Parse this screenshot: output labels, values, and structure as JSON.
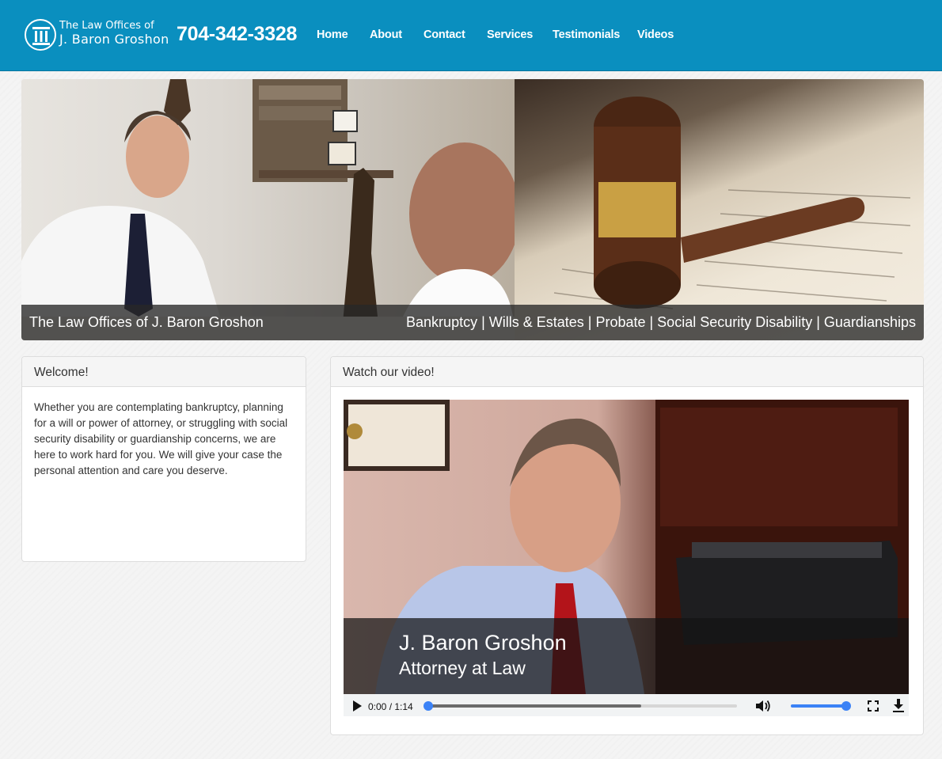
{
  "header": {
    "logo_line1": "The Law Offices of",
    "logo_line2": "J. Baron Groshon",
    "phone": "704-342-3328",
    "nav": [
      "Home",
      "About",
      "Contact",
      "Services",
      "Testimonials",
      "Videos"
    ]
  },
  "banner": {
    "caption_left": "The Law Offices of J. Baron Groshon",
    "caption_right": "Bankruptcy | Wills & Estates | Probate | Social Security Disability | Guardianships"
  },
  "welcome": {
    "title": "Welcome!",
    "body": "Whether you are contemplating bankruptcy, planning for a will or power of attorney, or struggling with social security disability or guardianship concerns, we are here to work hard for you. We will give your case the personal attention and care you deserve."
  },
  "video": {
    "title": "Watch our video!",
    "overlay_name": "J. Baron Groshon",
    "overlay_role": "Attorney at Law",
    "time": "0:00 / 1:14",
    "buffered_fraction": 0.69,
    "played_fraction": 0.0,
    "volume_fraction": 1.0,
    "icons": [
      "play-icon",
      "volume-icon",
      "fullscreen-icon",
      "download-icon"
    ]
  },
  "colors": {
    "header_bg": "#0a8fbf",
    "accent_blue": "#3b82f6"
  }
}
